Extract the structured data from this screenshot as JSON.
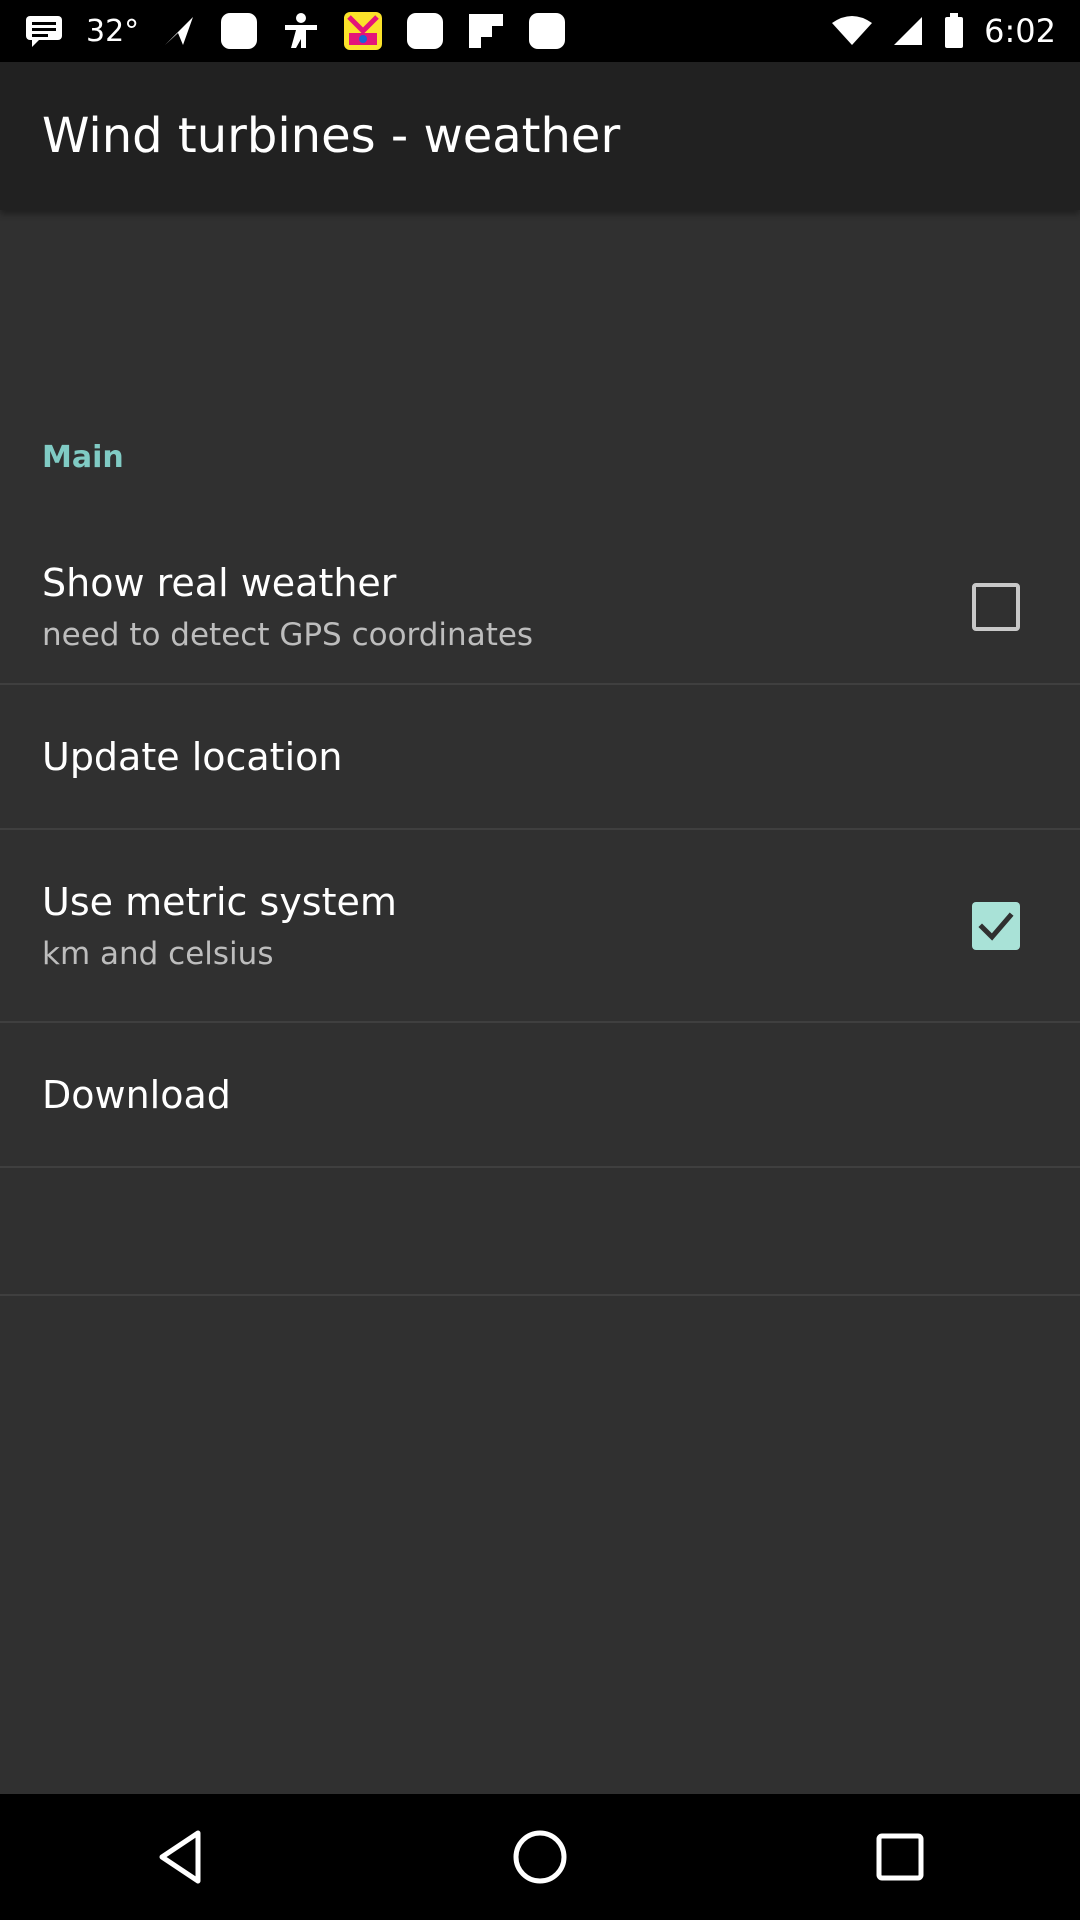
{
  "status_bar": {
    "temperature": "32°",
    "time": "6:02",
    "left_icons": [
      "message-icon",
      "temperature-text",
      "send-icon",
      "rounded-square-icon",
      "accessibility-icon",
      "pop-app-icon",
      "rounded-square-icon",
      "flipboard-icon",
      "rounded-square-icon"
    ],
    "right_icons": [
      "wifi-icon",
      "signal-icon",
      "battery-icon"
    ]
  },
  "app_bar": {
    "title": "Wind turbines - weather"
  },
  "section": {
    "header": "Main"
  },
  "settings": [
    {
      "title": "Show real weather",
      "subtitle": "need to detect GPS coordinates",
      "checkbox": "unchecked"
    },
    {
      "title": "Update location"
    },
    {
      "title": "Use metric system",
      "subtitle": "km and celsius",
      "checkbox": "checked"
    },
    {
      "title": "Download"
    }
  ],
  "colors": {
    "accent": "#80cbc4",
    "checkbox_checked": "#a9e2d7",
    "background": "#303030",
    "app_bar": "#212121"
  },
  "nav_bar": {
    "buttons": [
      "back-icon",
      "home-icon",
      "recents-icon"
    ]
  }
}
